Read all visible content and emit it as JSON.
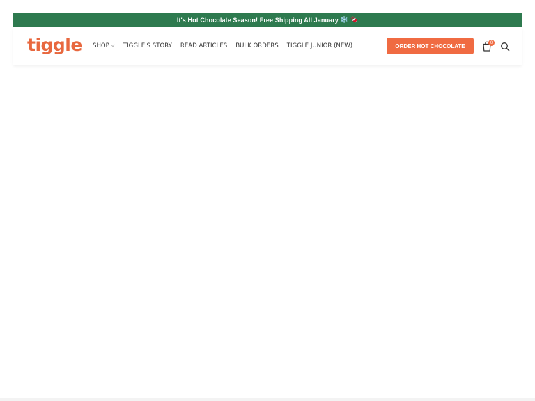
{
  "announcement": {
    "text": "It's Hot Chocolate Season! Free Shipping All January",
    "emoji": "❄️ 🍫"
  },
  "header": {
    "logo": "tiggle",
    "nav": [
      {
        "label": "SHOP",
        "has_dropdown": true
      },
      {
        "label": "TIGGLE'S STORY"
      },
      {
        "label": "READ ARTICLES"
      },
      {
        "label": "BULK ORDERS"
      },
      {
        "label": "TIGGLE JUNIOR (NEW)"
      }
    ],
    "cta_label": "ORDER HOT CHOCOLATE",
    "cart_count": "0"
  },
  "colors": {
    "announcement_bg": "#2e7a4f",
    "brand": "#e8683f",
    "cta": "#f06b42"
  },
  "icons": [
    "chevron-down-icon",
    "shopping-bag-icon",
    "search-icon"
  ]
}
